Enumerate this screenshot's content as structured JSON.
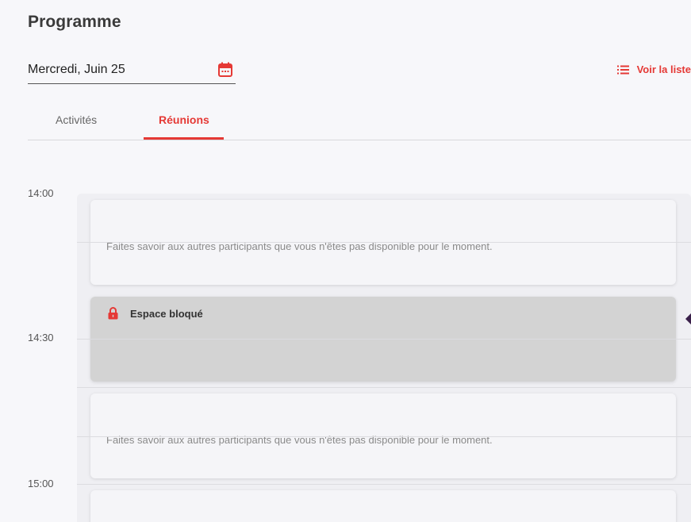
{
  "header": {
    "title": "Programme"
  },
  "date_picker": {
    "value": "Mercredi, Juin 25",
    "icon": "calendar-icon"
  },
  "view_list": {
    "label": "Voir la liste",
    "icon": "list-icon"
  },
  "tabs": [
    {
      "label": "Activités",
      "active": false
    },
    {
      "label": "Réunions",
      "active": true
    }
  ],
  "times": [
    "14:00",
    "14:30",
    "15:00"
  ],
  "slots": [
    {
      "type": "free",
      "hint": "Faites savoir aux autres participants que vous n'êtes pas disponible pour le moment."
    },
    {
      "type": "blocked",
      "label": "Espace bloqué",
      "icon": "lock-icon"
    },
    {
      "type": "free",
      "hint": "Faites savoir aux autres participants que vous n'êtes pas disponible pour le moment."
    },
    {
      "type": "free",
      "hint": ""
    }
  ],
  "colors": {
    "accent": "#e53935",
    "background": "#f7f7fa",
    "blocked": "#d3d3d3",
    "free_slot": "#f5f5f8"
  }
}
